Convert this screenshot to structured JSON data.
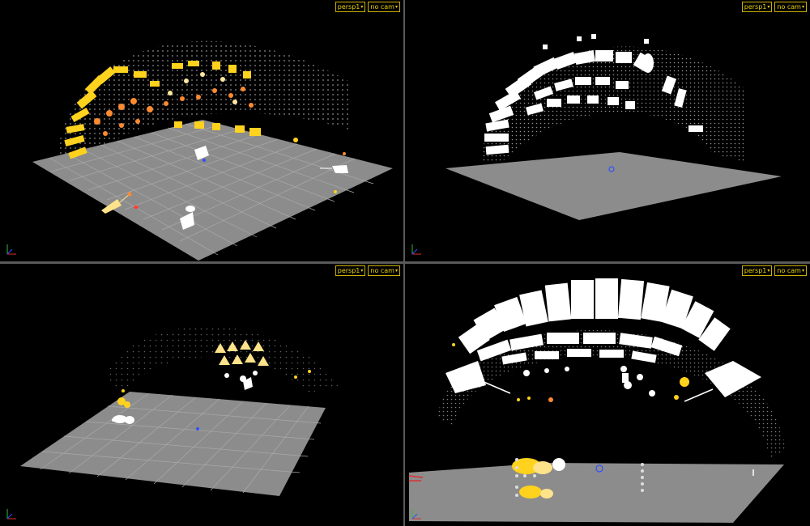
{
  "viewports": [
    {
      "id": "top-left",
      "camera_menu": "persp1",
      "cam_menu": "no cam"
    },
    {
      "id": "top-right",
      "camera_menu": "persp1",
      "cam_menu": "no cam"
    },
    {
      "id": "bottom-left",
      "camera_menu": "persp1",
      "cam_menu": "no cam"
    },
    {
      "id": "bottom-right",
      "camera_menu": "persp1",
      "cam_menu": "no cam"
    }
  ],
  "colors": {
    "background": "#000000",
    "grid_plane": "#8a8a8a",
    "grid_line": "#a8a8a8",
    "menu_text": "#e8d300",
    "light_yellow": "#ffd21e",
    "light_orange": "#ff7a2a",
    "light_white": "#ffffff",
    "axis_x": "#e03030",
    "axis_y": "#30c030",
    "axis_z": "#3050ff"
  },
  "icons": {
    "menu_caret": "chevron-down-icon",
    "axis_gizmo": "axis-gizmo-icon"
  }
}
